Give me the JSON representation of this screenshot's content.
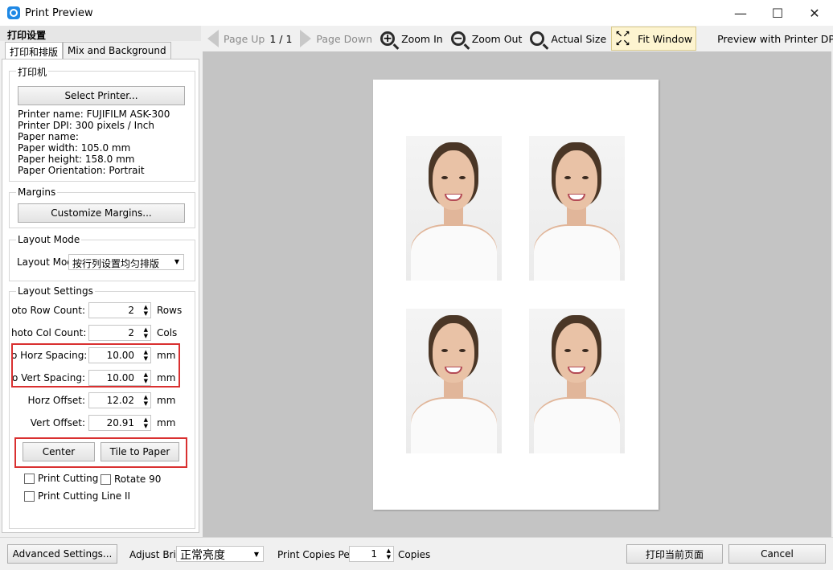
{
  "window": {
    "title": "Print Preview",
    "minimize": "—",
    "maximize": "☐",
    "close": "✕"
  },
  "left_panel": {
    "header": "打印设置",
    "tabs": [
      "打印和排版",
      "Mix and Background"
    ],
    "printer_group": {
      "title": "打印机",
      "select_button": "Select Printer...",
      "info": [
        "Printer name: FUJIFILM ASK-300",
        "Printer DPI: 300 pixels / Inch",
        "Paper name:",
        "Paper width: 105.0 mm",
        "Paper height: 158.0 mm",
        "Paper Orientation: Portrait"
      ]
    },
    "margins_group": {
      "title": "Margins",
      "button": "Customize Margins..."
    },
    "layout_mode_group": {
      "title": "Layout Mode",
      "label": "Layout Mod",
      "selected": "按行列设置均匀排版"
    },
    "layout_settings_group": {
      "title": "Layout Settings",
      "rows": [
        {
          "label": "oto Row Count:",
          "value": "2",
          "unit": "Rows"
        },
        {
          "label": "hoto Col Count:",
          "value": "2",
          "unit": "Cols"
        },
        {
          "label": "o Horz Spacing:",
          "value": "10.00",
          "unit": "mm"
        },
        {
          "label": "o Vert Spacing:",
          "value": "10.00",
          "unit": "mm"
        },
        {
          "label": "Horz Offset:",
          "value": "12.02",
          "unit": "mm"
        },
        {
          "label": "Vert Offset:",
          "value": "20.91",
          "unit": "mm"
        }
      ],
      "center_button": "Center",
      "tile_button": "Tile to Paper",
      "checkboxes": {
        "cutting_line": "Print Cutting L",
        "rotate": "Rotate 90",
        "cutting_line_2": "Print Cutting Line II"
      }
    }
  },
  "toolbar": {
    "page_up": "Page Up",
    "page_indicator": "1 / 1",
    "page_down": "Page Down",
    "zoom_in": "Zoom In",
    "zoom_out": "Zoom Out",
    "actual_size": "Actual Size",
    "fit_window": "Fit Window",
    "preview_dpi": "Preview with Printer DPI"
  },
  "preview": {
    "photo_count": 4
  },
  "bottom_bar": {
    "advanced_button": "Advanced Settings...",
    "brightness_label": "Adjust Brig",
    "brightness_value": "正常亮度",
    "copies_label": "Print Copies Per",
    "copies_value": "1",
    "copies_unit": "Copies",
    "print_button": "打印当前页面",
    "cancel_button": "Cancel"
  },
  "colors": {
    "highlight_border": "#d93030",
    "fit_window_bg": "#fdf4d0",
    "preview_bg": "#c4c4c4"
  }
}
